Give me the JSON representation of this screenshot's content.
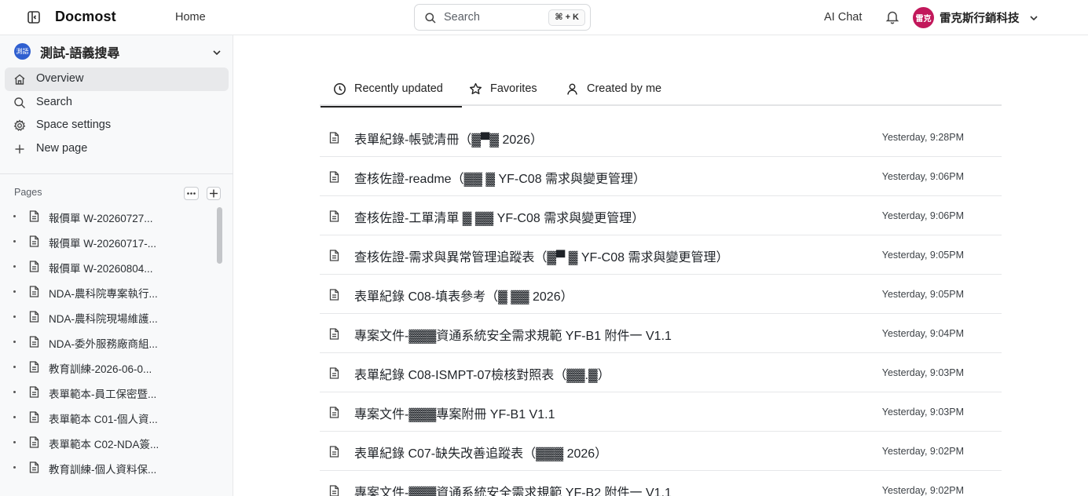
{
  "header": {
    "brand": "Docmost",
    "home_label": "Home",
    "search_placeholder": "Search",
    "search_shortcut": "⌘ + K",
    "ai_chat_label": "AI Chat",
    "user_avatar_text": "雷克",
    "user_name": "雷克斯行銷科技",
    "avatar_color": "#c2185b"
  },
  "sidebar": {
    "space_badge": "測語",
    "space_name": "測試-語義搜尋",
    "nav": [
      {
        "label": "Overview",
        "icon": "home-icon"
      },
      {
        "label": "Search",
        "icon": "search-icon"
      },
      {
        "label": "Space settings",
        "icon": "gear-icon"
      },
      {
        "label": "New page",
        "icon": "plus-icon"
      }
    ],
    "pages_title": "Pages",
    "pages": [
      "報價單 W-20260727...",
      "報價單 W-20260717-...",
      "報價單 W-20260804...",
      "NDA-農科院專案執行...",
      "NDA-農科院現場維護...",
      "NDA-委外服務廠商組...",
      "教育訓練-2026-06-0...",
      "表單範本-員工保密暨...",
      "表單範本 C01-個人資...",
      "表單範本 C02-NDA簽...",
      "教育訓練-個人資料保..."
    ]
  },
  "main": {
    "tabs": [
      {
        "label": "Recently updated",
        "icon": "clock-icon"
      },
      {
        "label": "Favorites",
        "icon": "star-icon"
      },
      {
        "label": "Created by me",
        "icon": "user-icon"
      }
    ],
    "rows": [
      {
        "title": "表單紀錄-帳號清冊（▓▀▓ 2026）",
        "time": "Yesterday, 9:28PM"
      },
      {
        "title": "查核佐證-readme（▓▓ ▓ YF-C08 需求與變更管理）",
        "time": "Yesterday, 9:06PM"
      },
      {
        "title": "查核佐證-工單清單 ▓ ▓▓ YF-C08 需求與變更管理）",
        "time": "Yesterday, 9:06PM"
      },
      {
        "title": "查核佐證-需求與異常管理追蹤表（▓▀ ▓ YF-C08 需求與變更管理）",
        "time": "Yesterday, 9:05PM"
      },
      {
        "title": "表單紀錄 C08-填表參考（▓ ▓▓ 2026）",
        "time": "Yesterday, 9:05PM"
      },
      {
        "title": "專案文件-▓▓▓資通系統安全需求規範 YF-B1 附件一 V1.1",
        "time": "Yesterday, 9:04PM"
      },
      {
        "title": "表單紀錄 C08-ISMPT-07檢核對照表（▓▓.▓）",
        "time": "Yesterday, 9:03PM"
      },
      {
        "title": "專案文件-▓▓▓專案附冊 YF-B1 V1.1",
        "time": "Yesterday, 9:03PM"
      },
      {
        "title": "表單紀錄 C07-缺失改善追蹤表（▓▓▓ 2026）",
        "time": "Yesterday, 9:02PM"
      },
      {
        "title": "專案文件-▓▓▓資通系統安全需求規範 YF-B2 附件一 V1.1",
        "time": "Yesterday, 9:02PM"
      }
    ]
  }
}
